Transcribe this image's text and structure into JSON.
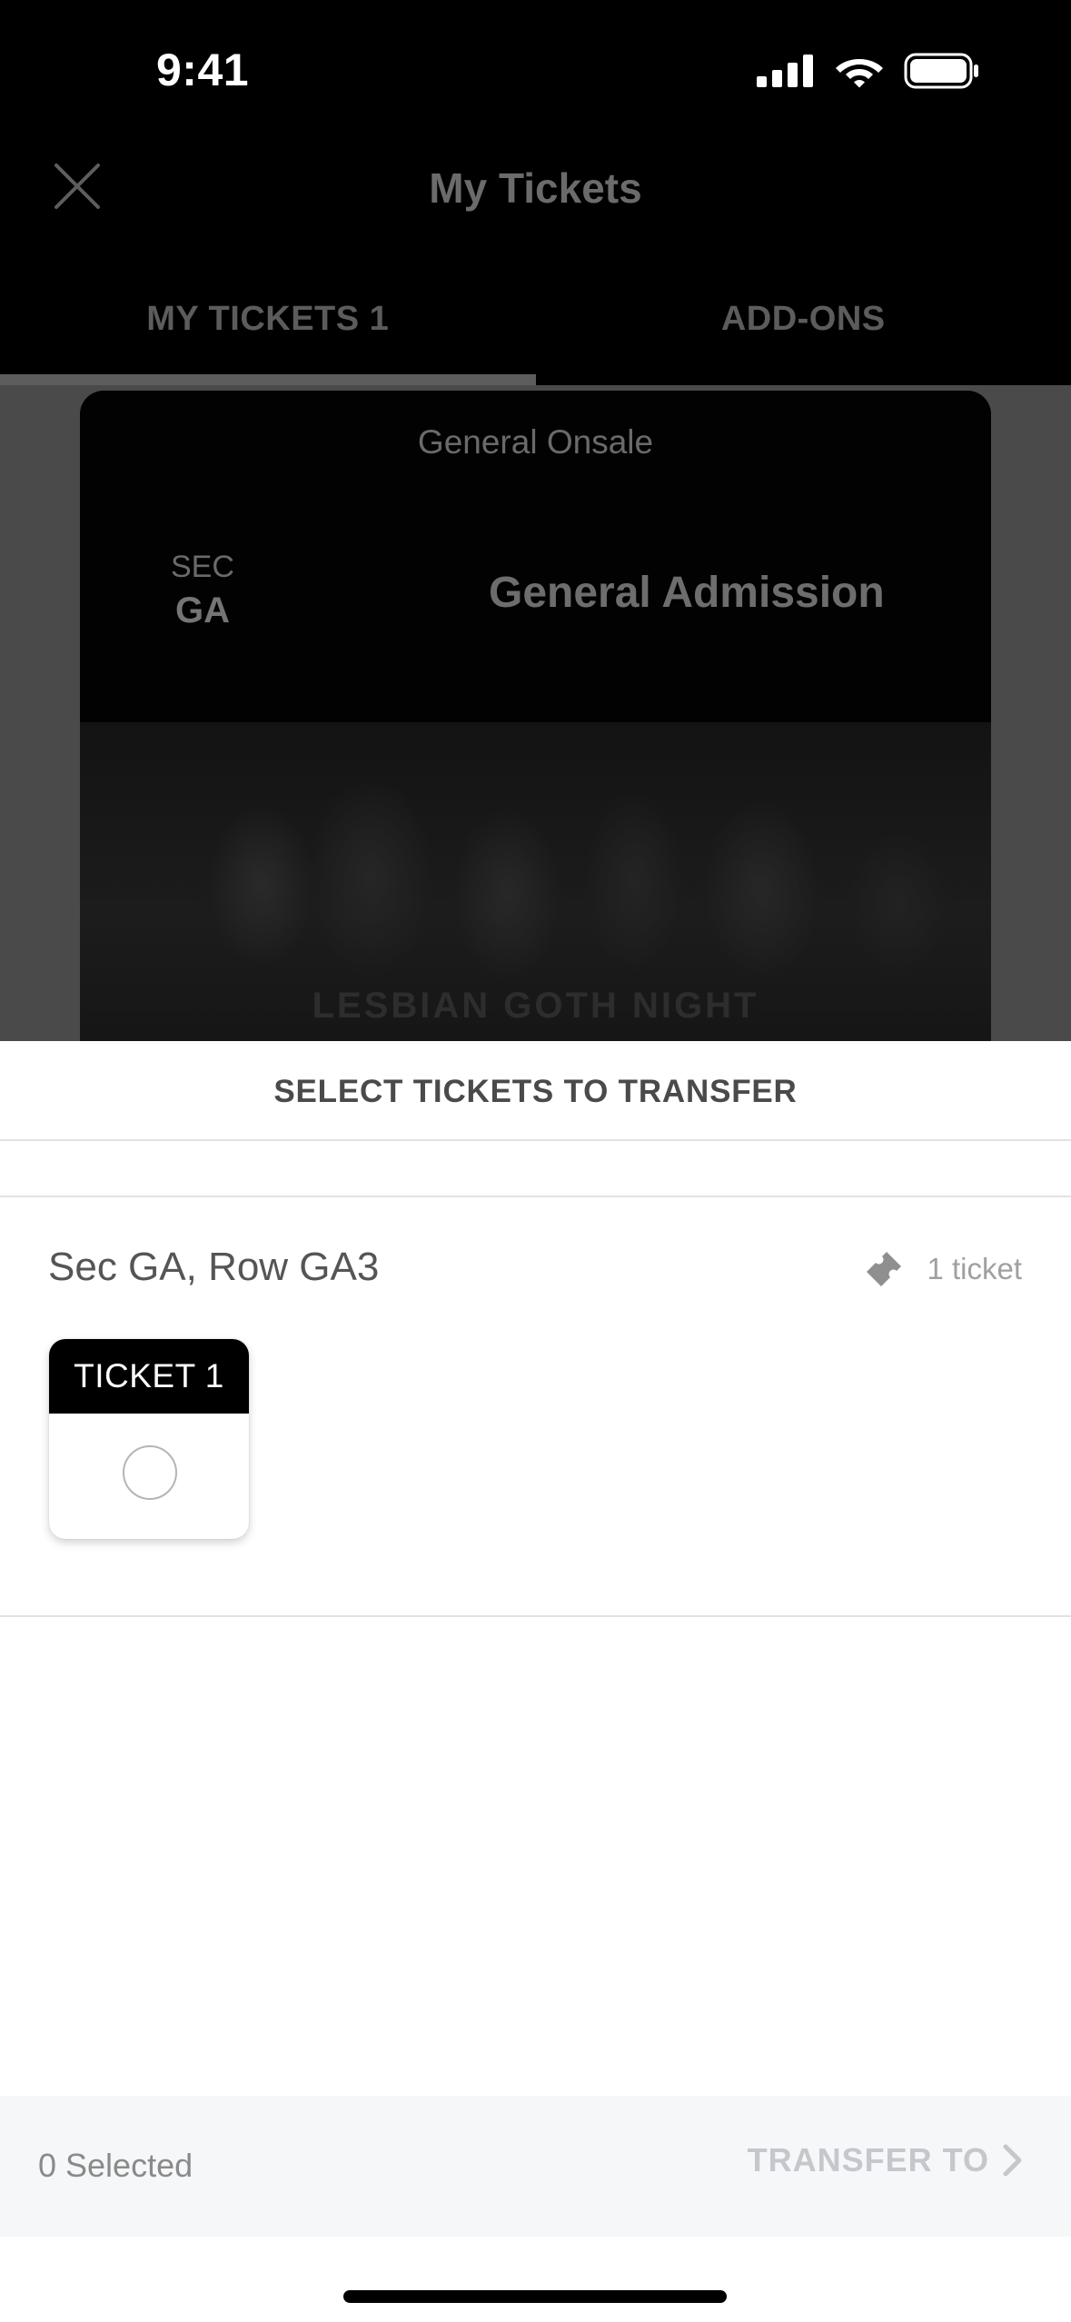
{
  "status_bar": {
    "time": "9:41",
    "icons": [
      "signal-icon",
      "wifi-icon",
      "battery-icon"
    ]
  },
  "header": {
    "title": "My Tickets",
    "close_icon": "close-icon",
    "tabs": [
      {
        "label": "MY TICKETS 1",
        "active": true
      },
      {
        "label": "ADD-ONS",
        "active": false
      }
    ]
  },
  "ticket_card": {
    "subtitle": "General Onsale",
    "sec_label": "SEC",
    "sec_value": "GA",
    "admission": "General Admission",
    "event_name": "LESBIAN GOTH NIGHT"
  },
  "sheet": {
    "title": "SELECT TICKETS TO TRANSFER",
    "group_label": "Sec GA, Row GA3",
    "ticket_count": "1 ticket",
    "ticket_icon": "ticket-icon",
    "tickets": [
      {
        "label": "TICKET 1",
        "selected": false
      }
    ]
  },
  "footer": {
    "selected_text": "0 Selected",
    "transfer_label": "TRANSFER TO",
    "transfer_icon": "chevron-right-icon"
  },
  "colors": {
    "header_bg": "#000000",
    "sheet_bg": "#ffffff",
    "footer_bg": "#f6f7f9",
    "disabled_text": "#c4c7cc"
  }
}
